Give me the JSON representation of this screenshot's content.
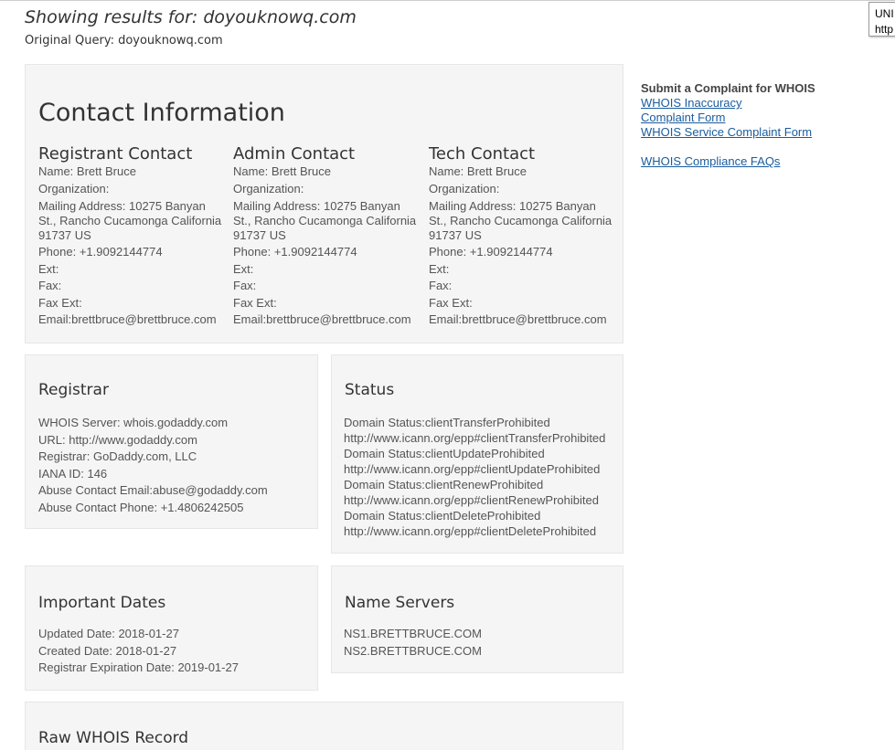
{
  "header": {
    "showing_results": "Showing results for: doyouknowq.com",
    "original_query": "Original Query: doyouknowq.com"
  },
  "tooltip": {
    "line1": "UNI",
    "line2": "http"
  },
  "contact": {
    "title": "Contact Information",
    "columns": [
      {
        "title": "Registrant Contact",
        "name": "Name: Brett Bruce",
        "organization": "Organization:",
        "mailing": "Mailing Address: 10275 Banyan St., Rancho Cucamonga California 91737 US",
        "phone": "Phone: +1.9092144774",
        "ext": "Ext:",
        "fax": "Fax:",
        "fax_ext": "Fax Ext:",
        "email": "Email:brettbruce@brettbruce.com"
      },
      {
        "title": "Admin Contact",
        "name": "Name: Brett Bruce",
        "organization": "Organization:",
        "mailing": "Mailing Address: 10275 Banyan St., Rancho Cucamonga California 91737 US",
        "phone": "Phone: +1.9092144774",
        "ext": "Ext:",
        "fax": "Fax:",
        "fax_ext": "Fax Ext:",
        "email": "Email:brettbruce@brettbruce.com"
      },
      {
        "title": "Tech Contact",
        "name": "Name: Brett Bruce",
        "organization": "Organization:",
        "mailing": "Mailing Address: 10275 Banyan St., Rancho Cucamonga California 91737 US",
        "phone": "Phone: +1.9092144774",
        "ext": "Ext:",
        "fax": "Fax:",
        "fax_ext": "Fax Ext:",
        "email": "Email:brettbruce@brettbruce.com"
      }
    ]
  },
  "registrar": {
    "title": "Registrar",
    "whois_server": "WHOIS Server: whois.godaddy.com",
    "url": "URL: http://www.godaddy.com",
    "registrar": "Registrar: GoDaddy.com, LLC",
    "iana_id": "IANA ID: 146",
    "abuse_email": "Abuse Contact Email:abuse@godaddy.com",
    "abuse_phone": "Abuse Contact Phone: +1.4806242505"
  },
  "status": {
    "title": "Status",
    "items": [
      {
        "status": "Domain Status:clientTransferProhibited",
        "url": "http://www.icann.org/epp#clientTransferProhibited"
      },
      {
        "status": "Domain Status:clientUpdateProhibited",
        "url": "http://www.icann.org/epp#clientUpdateProhibited"
      },
      {
        "status": "Domain Status:clientRenewProhibited",
        "url": "http://www.icann.org/epp#clientRenewProhibited"
      },
      {
        "status": "Domain Status:clientDeleteProhibited",
        "url": "http://www.icann.org/epp#clientDeleteProhibited"
      }
    ]
  },
  "dates": {
    "title": "Important Dates",
    "updated": "Updated Date: 2018-01-27",
    "created": "Created Date: 2018-01-27",
    "expiration": "Registrar Expiration Date: 2019-01-27"
  },
  "nameservers": {
    "title": "Name Servers",
    "ns1": "NS1.BRETTBRUCE.COM",
    "ns2": "NS2.BRETTBRUCE.COM"
  },
  "raw": {
    "title": "Raw WHOIS Record"
  },
  "sidebar": {
    "title": "Submit a Complaint for WHOIS",
    "links": [
      "WHOIS Inaccuracy",
      "Complaint Form",
      "WHOIS Service Complaint Form"
    ],
    "faq": "WHOIS Compliance FAQs"
  }
}
